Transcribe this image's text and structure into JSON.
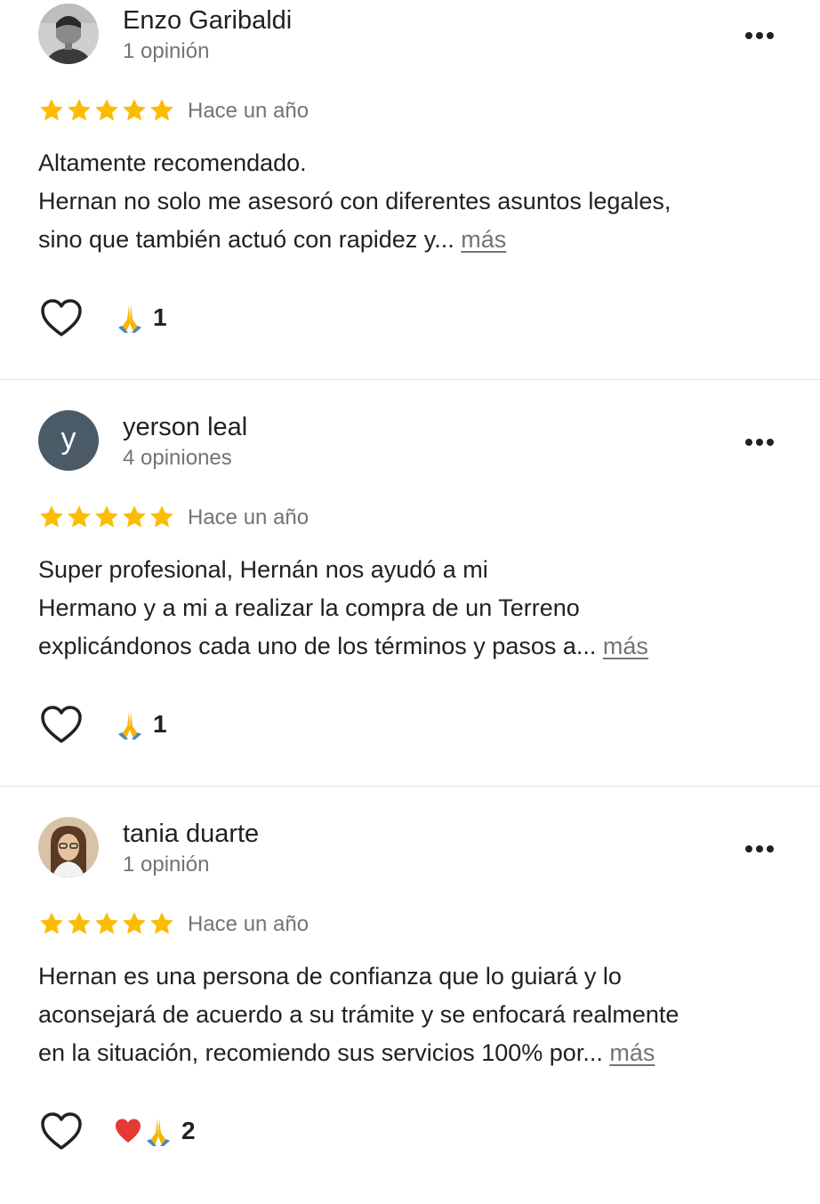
{
  "reviews": [
    {
      "author": "Enzo Garibaldi",
      "review_count": "1 opinión",
      "avatar": "photo-avatar",
      "rating": 5,
      "time": "Hace un año",
      "text_lines": [
        "Altamente recomendado.",
        "Hernan no solo me asesoró con diferentes asuntos legales,",
        "sino que también actuó con rapidez y..."
      ],
      "more_label": "más",
      "reactions": [
        "folded-hands-emoji"
      ],
      "reaction_count": "1"
    },
    {
      "author": "yerson leal",
      "review_count": "4 opiniones",
      "avatar_letter": "y",
      "rating": 5,
      "time": "Hace un año",
      "text_lines": [
        "Super profesional, Hernán nos ayudó a mi",
        "Hermano y a mi a realizar la compra de un Terreno",
        "explicándonos cada uno de los términos y pasos a..."
      ],
      "more_label": "más",
      "reactions": [
        "folded-hands-emoji"
      ],
      "reaction_count": "1"
    },
    {
      "author": "tania duarte",
      "review_count": "1 opinión",
      "avatar": "photo-avatar",
      "rating": 5,
      "time": "Hace un año",
      "text_lines": [
        "Hernan es una persona de confianza que lo guiará y lo",
        "aconsejará de acuerdo a su trámite y se enfocará realmente",
        "en la situación, recomiendo sus servicios 100% por..."
      ],
      "more_label": "más",
      "reactions": [
        "red-heart-emoji",
        "folded-hands-emoji"
      ],
      "reaction_count": "2"
    }
  ],
  "colors": {
    "star": "#fbbc04",
    "secondary_text": "#70757a",
    "primary_text": "#202124",
    "divider": "#e3e3e3",
    "letter_avatar_bg": "#4a5b67"
  }
}
